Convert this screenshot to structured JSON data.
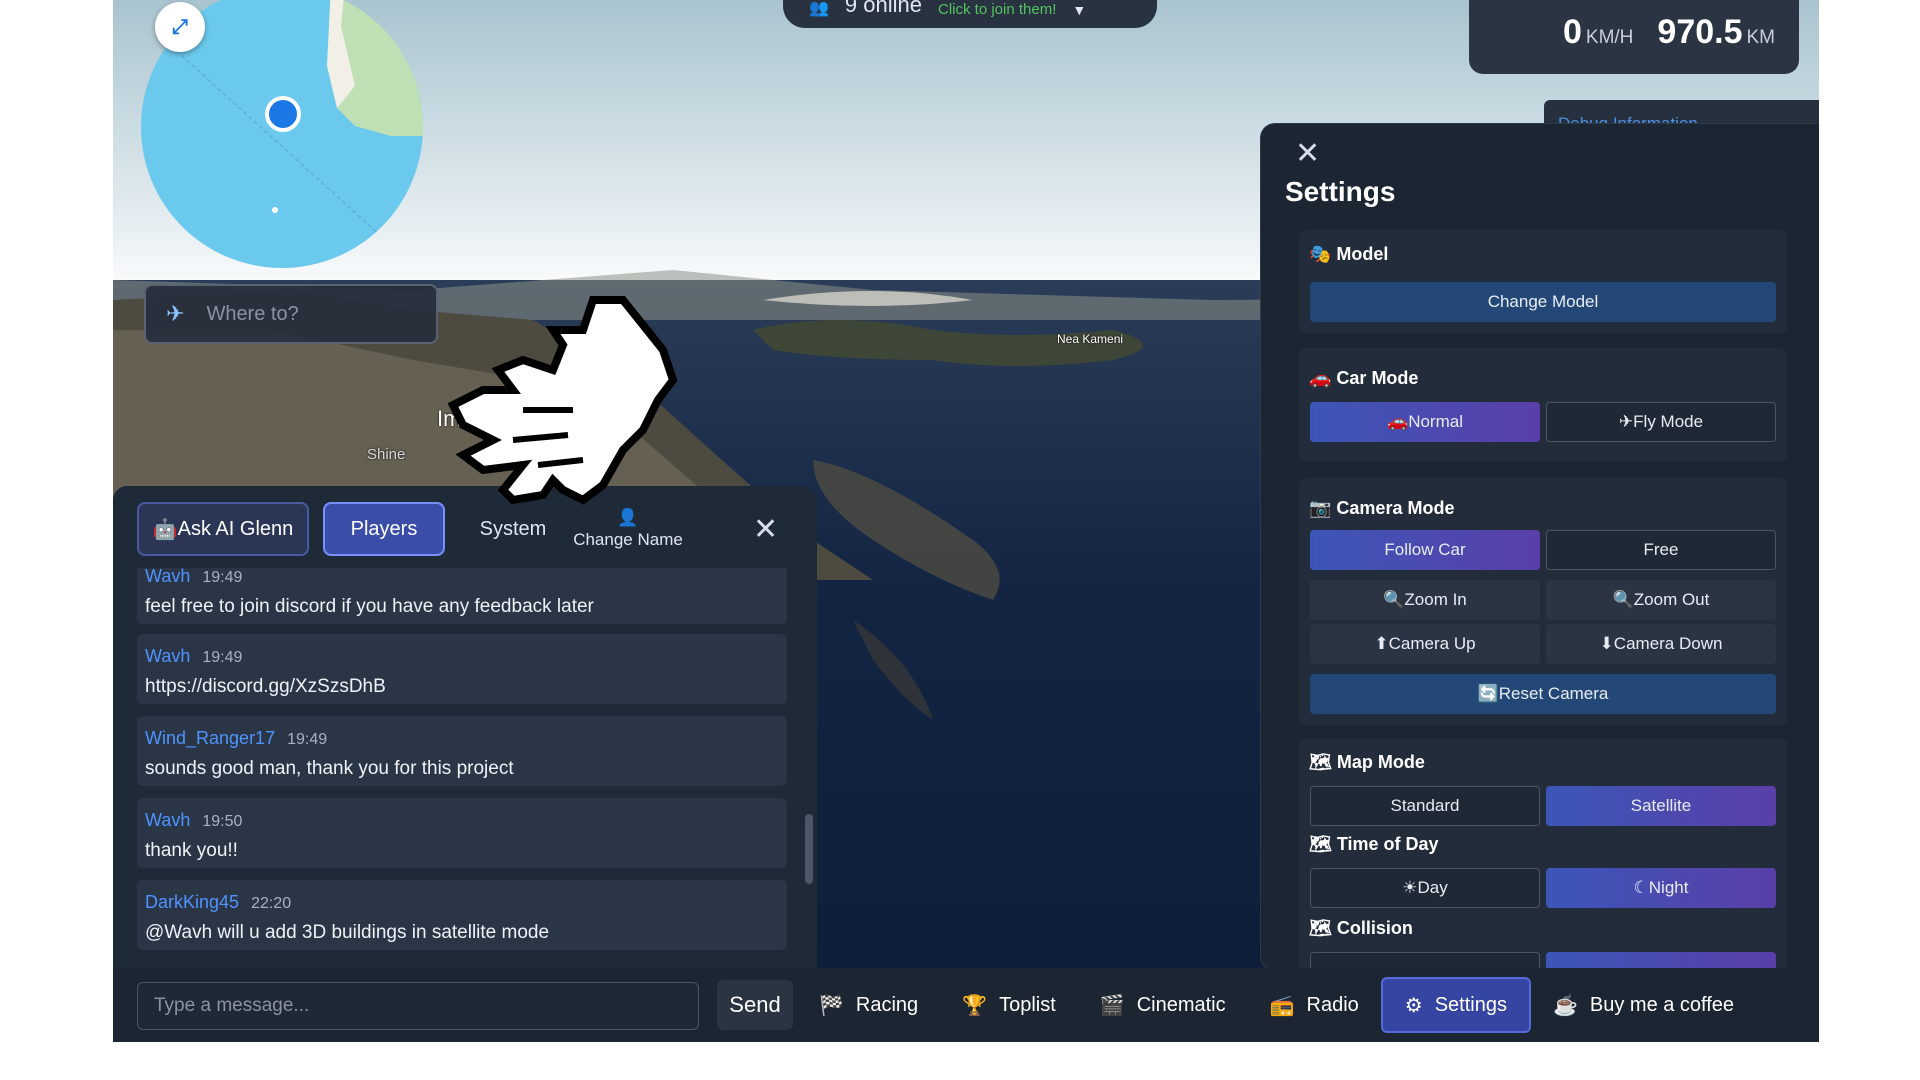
{
  "map": {
    "search_placeholder": "Where to?",
    "place_label": "Nea Kameni",
    "place_label_2": "Shine",
    "place_label_3": "Im"
  },
  "online": {
    "count": "9 online",
    "join": "Click to join them!"
  },
  "speed": {
    "value": "0",
    "unit": "KM/H",
    "distance": "970.5",
    "distance_unit": "KM"
  },
  "settings": {
    "title": "Settings",
    "model": {
      "heading": "Model",
      "change_label": "Change Model"
    },
    "car_mode": {
      "heading": "Car Mode",
      "normal": "Normal",
      "fly": "Fly Mode"
    },
    "camera_mode": {
      "heading": "Camera Mode",
      "follow": "Follow Car",
      "free": "Free",
      "zoom_in": "Zoom In",
      "zoom_out": "Zoom Out",
      "camera_up": "Camera Up",
      "camera_down": "Camera Down",
      "reset": "Reset Camera"
    },
    "map_mode": {
      "heading": "Map Mode",
      "standard": "Standard",
      "satellite": "Satellite"
    },
    "time_of_day": {
      "heading": "Time of Day",
      "day": "Day",
      "night": "Night"
    },
    "collision": {
      "heading": "Collision"
    }
  },
  "nav": {
    "racing": "Racing",
    "toplist": "Toplist",
    "cinematic": "Cinematic",
    "radio": "Radio",
    "settings": "Settings",
    "coffee": "Buy me a coffee"
  },
  "chat": {
    "tabs": {
      "ai": "Ask AI Glenn",
      "players": "Players",
      "system": "System",
      "change_name": "Change Name"
    },
    "messages": [
      {
        "user": "Wavh",
        "time": "19:49",
        "text": "feel free to join discord if you have any feedback later"
      },
      {
        "user": "Wavh",
        "time": "19:49",
        "text": "https://discord.gg/XzSzsDhB"
      },
      {
        "user": "Wind_Ranger17",
        "time": "19:49",
        "text": "sounds good man, thank you for this project"
      },
      {
        "user": "Wavh",
        "time": "19:50",
        "text": "thank you!!"
      },
      {
        "user": "DarkKing45",
        "time": "22:20",
        "text": "@Wavh will u add 3D buildings in satellite mode"
      }
    ],
    "input_placeholder": "Type a message...",
    "send_label": "Send"
  },
  "colors": {
    "accent": "#3c56b8",
    "user_name": "#4f93ff",
    "panel": "#1c2532"
  }
}
